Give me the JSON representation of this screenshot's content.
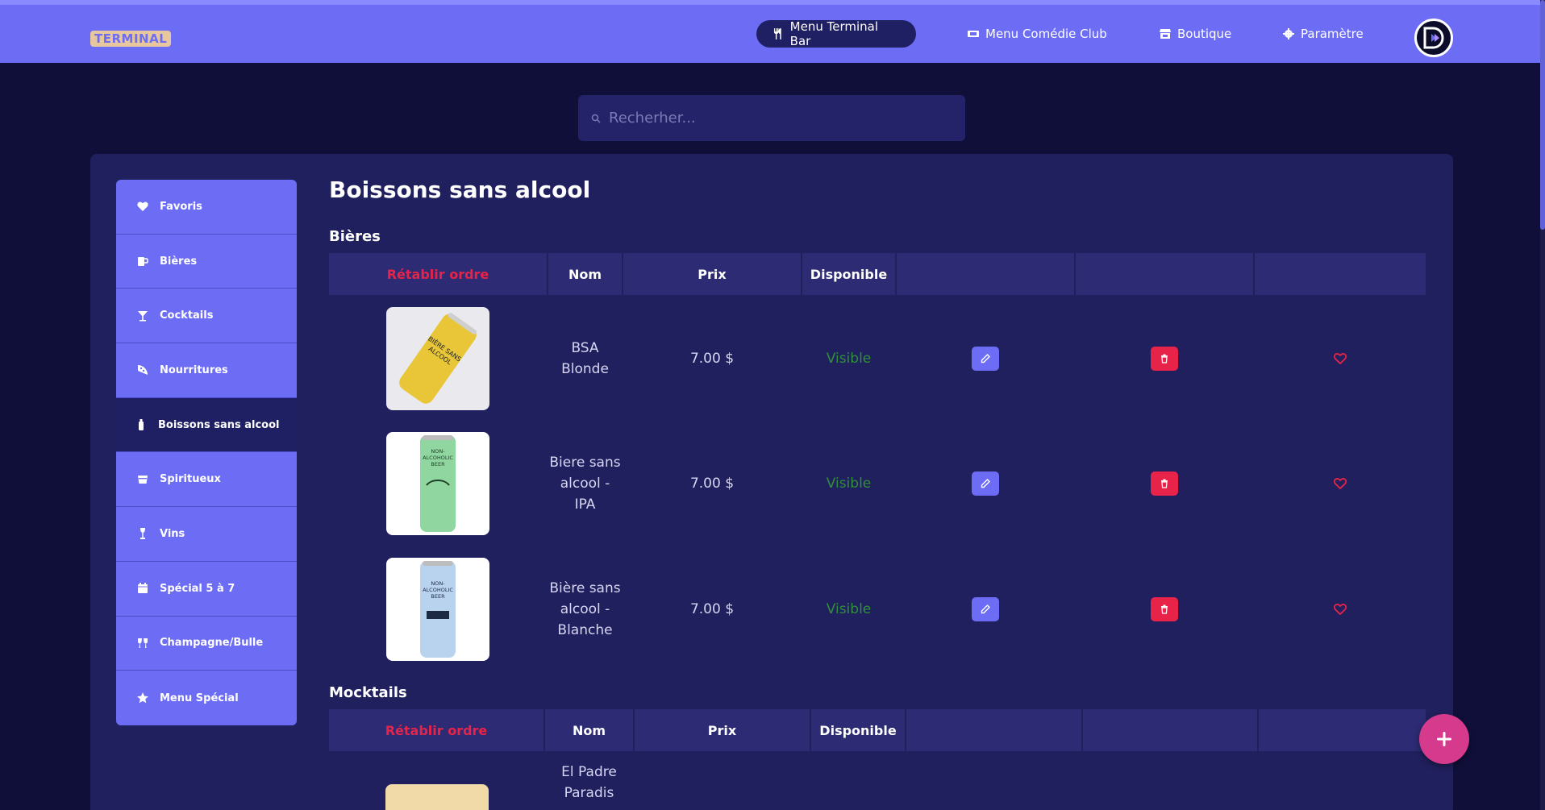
{
  "brand": {
    "logo_text": "TERMINAL"
  },
  "nav": [
    {
      "label": "Menu Terminal Bar",
      "icon": "utensils-icon",
      "active": true
    },
    {
      "label": "Menu Comédie Club",
      "icon": "ticket-icon",
      "active": false
    },
    {
      "label": "Boutique",
      "icon": "store-icon",
      "active": false
    },
    {
      "label": "Paramètre",
      "icon": "gear-icon",
      "active": false
    }
  ],
  "search": {
    "placeholder": "Recherher..."
  },
  "sidebar": {
    "items": [
      {
        "label": "Favoris",
        "icon": "heart-icon"
      },
      {
        "label": "Bières",
        "icon": "beer-mug-icon"
      },
      {
        "label": "Cocktails",
        "icon": "cocktail-icon"
      },
      {
        "label": "Nourritures",
        "icon": "pizza-icon"
      },
      {
        "label": "Boissons sans alcool",
        "icon": "bottle-icon",
        "active": true
      },
      {
        "label": "Spiritueux",
        "icon": "glass-icon"
      },
      {
        "label": "Vins",
        "icon": "wine-glass-icon"
      },
      {
        "label": "Spécial 5 à 7",
        "icon": "calendar-icon"
      },
      {
        "label": "Champagne/Bulle",
        "icon": "glasses-cheers-icon"
      },
      {
        "label": "Menu Spécial",
        "icon": "star-icon"
      }
    ]
  },
  "page": {
    "title": "Boissons sans alcool"
  },
  "sections": [
    {
      "title": "Bières",
      "headers": {
        "reset": "Rétablir ordre",
        "name": "Nom",
        "price": "Prix",
        "available": "Disponible"
      },
      "rows": [
        {
          "name": "BSA Blonde",
          "price": "7.00 $",
          "status": "Visible",
          "can_color": "#e8c637",
          "can_label": "BIÈRE SANS ALCOOL"
        },
        {
          "name": "Biere sans alcool - IPA",
          "price": "7.00 $",
          "status": "Visible",
          "can_color": "#8fd6a0",
          "can_label": "NON-ALCOHOLIC BEER"
        },
        {
          "name": "Bière sans alcool - Blanche",
          "price": "7.00 $",
          "status": "Visible",
          "can_color": "#b9d3ef",
          "can_label": "NON-ALCOHOLIC BEER"
        }
      ]
    },
    {
      "title": "Mocktails",
      "headers": {
        "reset": "Rétablir ordre",
        "name": "Nom",
        "price": "Prix",
        "available": "Disponible"
      },
      "rows": [
        {
          "name": "El Padre Paradis",
          "thumb_color": "#f2d9a8"
        }
      ]
    }
  ],
  "colors": {
    "accent": "#6c6cf5",
    "danger": "#e8234a",
    "fab": "#d63a8c",
    "visible": "#2f8f3a",
    "background": "#100f3a"
  }
}
